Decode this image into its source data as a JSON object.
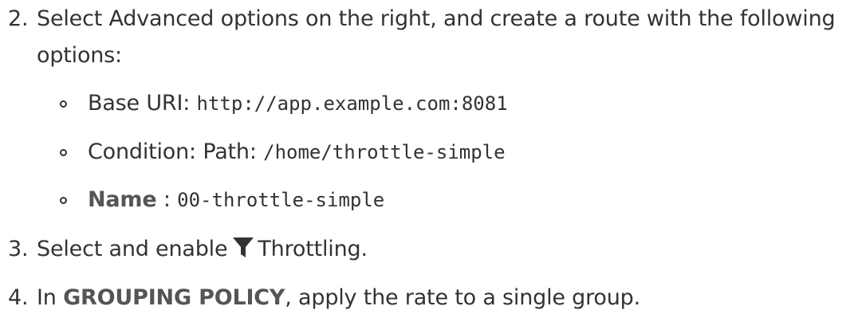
{
  "steps": [
    {
      "number": "2.",
      "line1": "Select Advanced options on the right, and create a route with the following",
      "line2": "options:",
      "options": [
        {
          "label": "Base URI:",
          "value": "http://app.example.com:8081"
        },
        {
          "label": "Condition: Path:",
          "value": "/home/throttle-simple"
        },
        {
          "label": "Name",
          "separator": ":",
          "value": "00-throttle-simple"
        }
      ]
    },
    {
      "number": "3.",
      "before": "Select and enable",
      "icon": "filter-icon",
      "after": "Throttling."
    },
    {
      "number": "4.",
      "before": "In",
      "strong": "GROUPING POLICY",
      "after": ", apply the rate to a single group."
    }
  ],
  "colors": {
    "text": "#333333",
    "strong_text": "#555555",
    "background": "#ffffff"
  }
}
